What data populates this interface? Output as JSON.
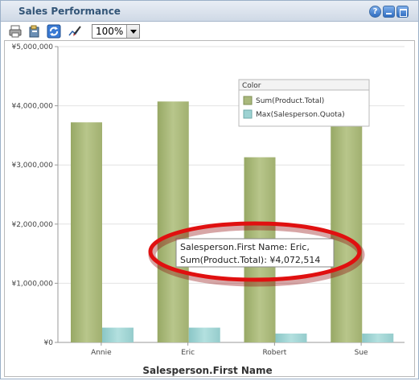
{
  "window": {
    "title": "Sales Performance"
  },
  "toolbar": {
    "zoom_value": "100%",
    "buttons": [
      "print-icon",
      "export-icon",
      "refresh-icon",
      "edit-icon"
    ]
  },
  "chart_data": {
    "type": "bar",
    "categories": [
      "Annie",
      "Eric",
      "Robert",
      "Sue"
    ],
    "series": [
      {
        "name": "Sum(Product.Total)",
        "color": "#a9b87c",
        "values": [
          3720000,
          4072514,
          3130000,
          3960000
        ]
      },
      {
        "name": "Max(Salesperson.Quota)",
        "color": "#9dd2d2",
        "values": [
          250000,
          250000,
          150000,
          150000
        ]
      }
    ],
    "xlabel": "Salesperson.First Name",
    "ylabel": "",
    "ylim": [
      0,
      5000000
    ],
    "yticks": [
      "¥0",
      "¥1,000,000",
      "¥2,000,000",
      "¥3,000,000",
      "¥4,000,000",
      "¥5,000,000"
    ],
    "grid": true,
    "legend": {
      "title": "Color",
      "placement": "top-right"
    },
    "tooltip": {
      "line1": "Salesperson.First Name: Eric,",
      "line2": "Sum(Product.Total): ¥4,072,514"
    }
  }
}
